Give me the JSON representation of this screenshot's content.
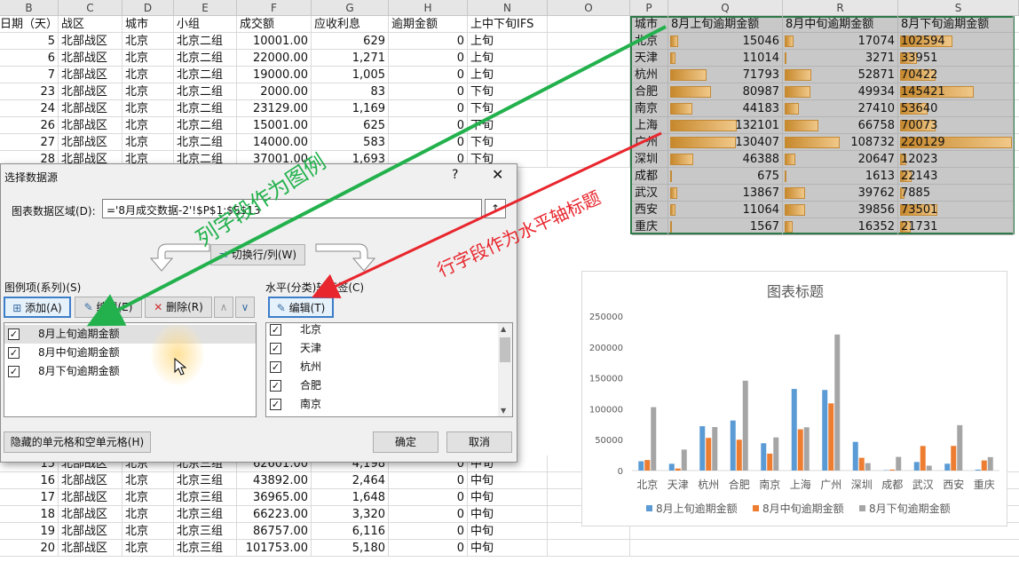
{
  "columns": [
    {
      "letter": "B",
      "header": "日期（天）"
    },
    {
      "letter": "C",
      "header": "战区"
    },
    {
      "letter": "D",
      "header": "城市"
    },
    {
      "letter": "E",
      "header": "小组"
    },
    {
      "letter": "F",
      "header": "成交额"
    },
    {
      "letter": "G",
      "header": "应收利息"
    },
    {
      "letter": "H",
      "header": "逾期金额"
    },
    {
      "letter": "N",
      "header": "上中下旬IFS"
    },
    {
      "letter": "O",
      "header": ""
    }
  ],
  "right_columns": [
    {
      "letter": "P"
    },
    {
      "letter": "Q"
    },
    {
      "letter": "R"
    },
    {
      "letter": "S"
    }
  ],
  "rows_top": [
    [
      "5",
      "北部战区",
      "北京",
      "北京二组",
      "10001.00",
      "629",
      "0",
      "上旬"
    ],
    [
      "6",
      "北部战区",
      "北京",
      "北京二组",
      "22000.00",
      "1,271",
      "0",
      "上旬"
    ],
    [
      "7",
      "北部战区",
      "北京",
      "北京二组",
      "19000.00",
      "1,005",
      "0",
      "上旬"
    ],
    [
      "23",
      "北部战区",
      "北京",
      "北京二组",
      "2000.00",
      "83",
      "0",
      "下旬"
    ],
    [
      "24",
      "北部战区",
      "北京",
      "北京二组",
      "23129.00",
      "1,169",
      "0",
      "下旬"
    ],
    [
      "26",
      "北部战区",
      "北京",
      "北京二组",
      "15001.00",
      "625",
      "0",
      "下旬"
    ],
    [
      "27",
      "北部战区",
      "北京",
      "北京二组",
      "14000.00",
      "583",
      "0",
      "下旬"
    ],
    [
      "28",
      "北部战区",
      "北京",
      "北京二组",
      "37001.00",
      "1,693",
      "0",
      "下旬"
    ]
  ],
  "rows_bottom": [
    [
      "15",
      "北部战区",
      "北京",
      "北京三组",
      "62601.00",
      "4,198",
      "0",
      "中旬"
    ],
    [
      "16",
      "北部战区",
      "北京",
      "北京三组",
      "43892.00",
      "2,464",
      "0",
      "中旬"
    ],
    [
      "17",
      "北部战区",
      "北京",
      "北京三组",
      "36965.00",
      "1,648",
      "0",
      "中旬"
    ],
    [
      "18",
      "北部战区",
      "北京",
      "北京三组",
      "66223.00",
      "3,320",
      "0",
      "中旬"
    ],
    [
      "19",
      "北部战区",
      "北京",
      "北京三组",
      "86757.00",
      "6,116",
      "0",
      "中旬"
    ],
    [
      "20",
      "北部战区",
      "北京",
      "北京三组",
      "101753.00",
      "5,180",
      "0",
      "中旬"
    ]
  ],
  "right_table": {
    "headers": [
      "城市",
      "8月上旬逾期金额",
      "8月中旬逾期金额",
      "8月下旬逾期金额"
    ],
    "rows": [
      [
        "北京",
        "15046",
        "17074",
        "102594"
      ],
      [
        "天津",
        "11014",
        "3271",
        "33951"
      ],
      [
        "杭州",
        "71793",
        "52871",
        "70422"
      ],
      [
        "合肥",
        "80987",
        "49934",
        "145421"
      ],
      [
        "南京",
        "44183",
        "27410",
        "53640"
      ],
      [
        "上海",
        "132101",
        "66758",
        "70073"
      ],
      [
        "广州",
        "130407",
        "108732",
        "220129"
      ],
      [
        "深圳",
        "46388",
        "20647",
        "12023"
      ],
      [
        "成都",
        "675",
        "1613",
        "22143"
      ],
      [
        "武汉",
        "13867",
        "39762",
        "7885"
      ],
      [
        "西安",
        "11064",
        "39856",
        "73501"
      ],
      [
        "重庆",
        "1567",
        "16352",
        "21731"
      ]
    ],
    "databar_max": 220129
  },
  "dialog": {
    "title": "选择数据源",
    "help": "?",
    "close": "✕",
    "range_label": "图表数据区域(D):",
    "range_value": "='8月成交数据-2'!$P$1:$S$13",
    "collapse_icon": "↑",
    "switch_button": "切换行/列(W)",
    "legend_label": "图例项(系列)(S)",
    "add_button": "添加(A)",
    "edit_button": "编辑(E)",
    "delete_button": "删除(R)",
    "up_icon": "∧",
    "down_icon": "∨",
    "axis_label": "水平(分类)轴标签(C)",
    "axis_edit_button": "编辑(T)",
    "series": [
      "8月上旬逾期金额",
      "8月中旬逾期金额",
      "8月下旬逾期金额"
    ],
    "categories": [
      "北京",
      "天津",
      "杭州",
      "合肥",
      "南京"
    ],
    "hidden_cells_button": "隐藏的单元格和空单元格(H)",
    "ok_button": "确定",
    "cancel_button": "取消",
    "check_mark": "✓"
  },
  "annotations": {
    "green_text": "列字段作为图例",
    "red_text": "行字段作为水平轴标题",
    "green_color": "#22b14c",
    "red_color": "#e8262d"
  },
  "chart_data": {
    "type": "bar",
    "title": "图表标题",
    "categories": [
      "北京",
      "天津",
      "杭州",
      "合肥",
      "南京",
      "上海",
      "广州",
      "深圳",
      "成都",
      "武汉",
      "西安",
      "重庆"
    ],
    "series": [
      {
        "name": "8月上旬逾期金额",
        "color": "#5b9bd5",
        "values": [
          15046,
          11014,
          71793,
          80987,
          44183,
          132101,
          130407,
          46388,
          675,
          13867,
          11064,
          1567
        ]
      },
      {
        "name": "8月中旬逾期金额",
        "color": "#ed7d31",
        "values": [
          17074,
          3271,
          52871,
          49934,
          27410,
          66758,
          108732,
          20647,
          1613,
          39762,
          39856,
          16352
        ]
      },
      {
        "name": "8月下旬逾期金额",
        "color": "#a5a5a5",
        "values": [
          102594,
          33951,
          70422,
          145421,
          53640,
          70073,
          220129,
          12023,
          22143,
          7885,
          73501,
          21731
        ]
      }
    ],
    "y_ticks": [
      "0",
      "50000",
      "100000",
      "150000",
      "200000",
      "250000"
    ],
    "ylim": [
      0,
      250000
    ],
    "grid": false,
    "legend_position": "bottom"
  }
}
